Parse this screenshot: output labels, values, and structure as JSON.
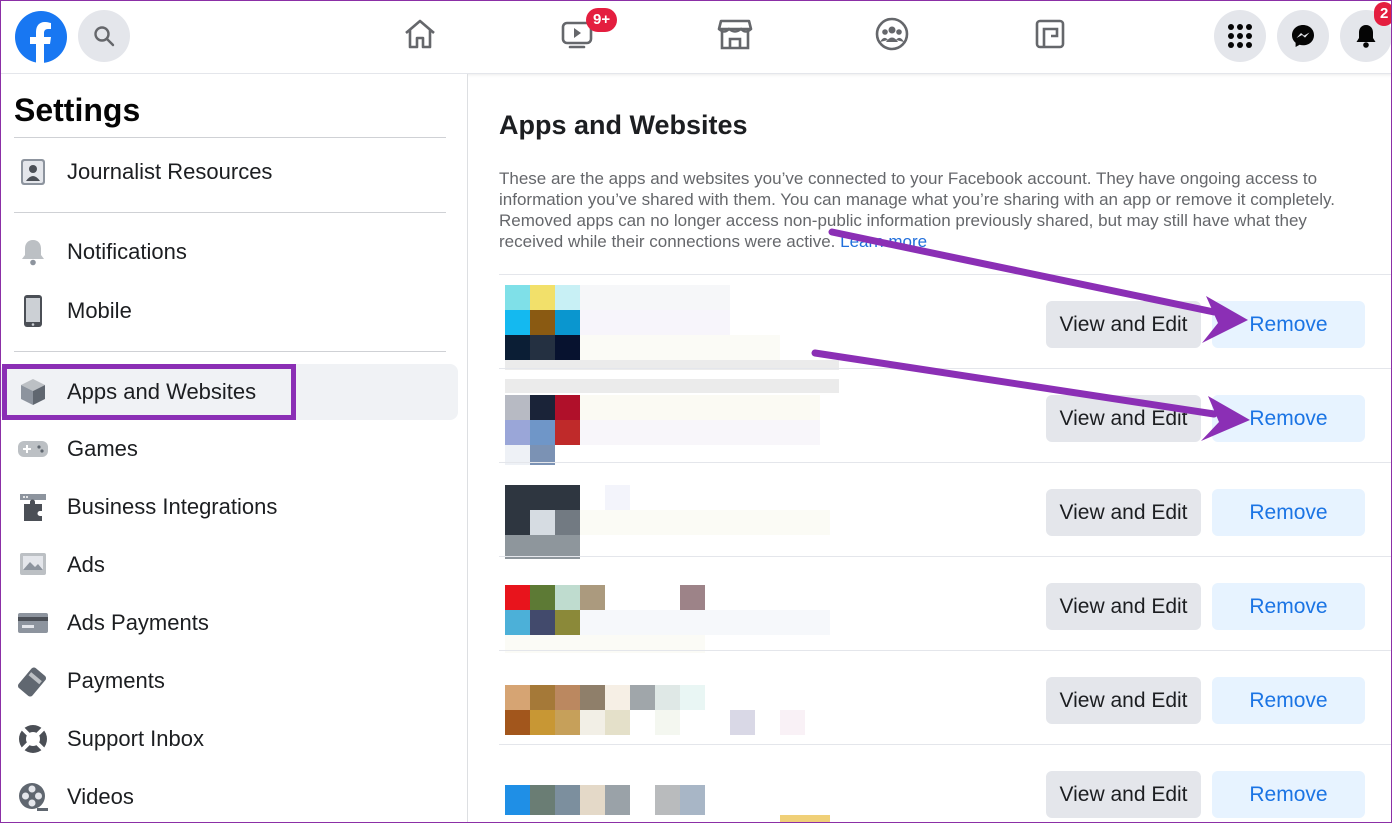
{
  "topbar": {
    "watch_badge": "9+",
    "notifications_badge": "2",
    "icons": [
      "facebook-logo",
      "search-icon",
      "home-icon",
      "watch-icon",
      "marketplace-icon",
      "groups-icon",
      "gaming-icon",
      "menu-grid-icon",
      "messenger-icon",
      "bell-icon"
    ]
  },
  "sidebar": {
    "title": "Settings",
    "items": [
      {
        "label": "Journalist Resources",
        "icon": "journalist-icon"
      },
      {
        "label": "Notifications",
        "icon": "bell-icon"
      },
      {
        "label": "Mobile",
        "icon": "phone-icon"
      },
      {
        "label": "Apps and Websites",
        "icon": "cube-icon"
      },
      {
        "label": "Games",
        "icon": "gamepad-icon"
      },
      {
        "label": "Business Integrations",
        "icon": "puzzle-icon"
      },
      {
        "label": "Ads",
        "icon": "ads-icon"
      },
      {
        "label": "Ads Payments",
        "icon": "card-icon"
      },
      {
        "label": "Payments",
        "icon": "payments-icon"
      },
      {
        "label": "Support Inbox",
        "icon": "lifebuoy-icon"
      },
      {
        "label": "Videos",
        "icon": "film-reel-icon"
      }
    ],
    "active_item": "Apps and Websites"
  },
  "main": {
    "title": "Apps and Websites",
    "description": "These are the apps and websites you’ve connected to your Facebook account. They have ongoing access to information you’ve shared with them. You can manage what you’re sharing with an app or remove it completely. Removed apps can no longer access non-public information previously shared, but may still have what they received while their connections were active.",
    "learn_more": "Learn more",
    "apps": [
      {
        "edit_label": "View and Edit",
        "remove_label": "Remove"
      },
      {
        "edit_label": "View and Edit",
        "remove_label": "Remove"
      },
      {
        "edit_label": "View and Edit",
        "remove_label": "Remove"
      },
      {
        "edit_label": "View and Edit",
        "remove_label": "Remove"
      },
      {
        "edit_label": "View and Edit",
        "remove_label": "Remove"
      },
      {
        "edit_label": "View and Edit",
        "remove_label": "Remove"
      }
    ]
  },
  "colors": {
    "accent": "#1b74e4",
    "annotation": "#8b2fb5",
    "badge": "#e41e3f"
  }
}
